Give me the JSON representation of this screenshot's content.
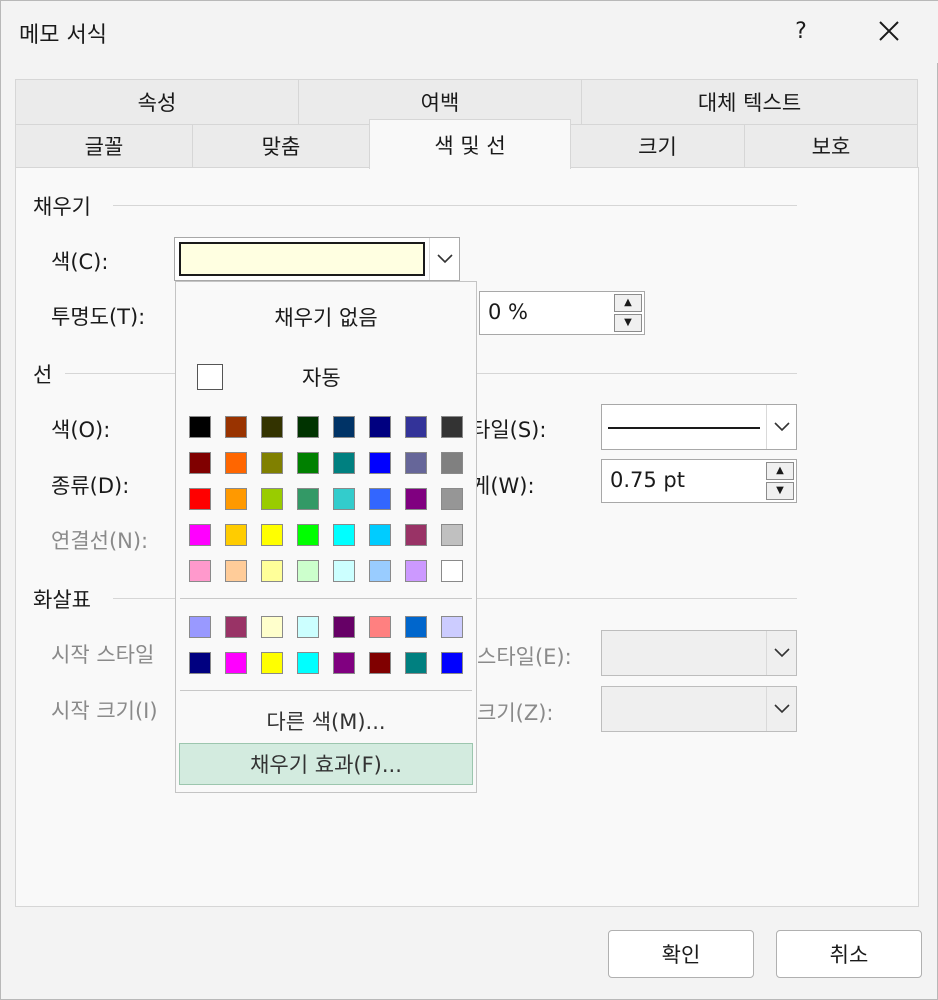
{
  "window": {
    "title": "메모 서식",
    "help": "?",
    "close_icon": "close-icon"
  },
  "tabs_row1": [
    "속성",
    "여백",
    "대체 텍스트"
  ],
  "tabs_row2": [
    "글꼴",
    "맞춤",
    "색 및 선",
    "크기",
    "보호"
  ],
  "active_tab": "색 및 선",
  "fill": {
    "section": "채우기",
    "color_label": "색(C):",
    "color_value": "#ffffe1",
    "transparency_label": "투명도(T):",
    "transparency_value": "0 %"
  },
  "line": {
    "section": "선",
    "color_label": "색(O):",
    "type_label": "종류(D):",
    "connector_label": "연결선(N):",
    "style_label": "타일(S):",
    "weight_label": "게(W):",
    "weight_value": "0.75 pt"
  },
  "arrows": {
    "section": "화살표",
    "begin_style_label": "시작 스타일",
    "begin_size_label": "시작 크기(I)",
    "end_style_label": "스타일(E):",
    "end_size_label": "크기(Z):"
  },
  "color_popup": {
    "no_fill": "채우기 없음",
    "automatic": "자동",
    "more_colors": "다른 색(M)...",
    "fill_effects": "채우기 효과(F)...",
    "standard_colors": [
      [
        "#000000",
        "#993300",
        "#333300",
        "#003300",
        "#003366",
        "#000080",
        "#333399",
        "#333333"
      ],
      [
        "#800000",
        "#ff6600",
        "#808000",
        "#008000",
        "#008080",
        "#0000ff",
        "#666699",
        "#808080"
      ],
      [
        "#ff0000",
        "#ff9900",
        "#99cc00",
        "#339966",
        "#33cccc",
        "#3366ff",
        "#800080",
        "#969696"
      ],
      [
        "#ff00ff",
        "#ffcc00",
        "#ffff00",
        "#00ff00",
        "#00ffff",
        "#00ccff",
        "#993366",
        "#c0c0c0"
      ],
      [
        "#ff99cc",
        "#ffcc99",
        "#ffff99",
        "#ccffcc",
        "#ccffff",
        "#99ccff",
        "#cc99ff",
        "#ffffff"
      ]
    ],
    "extra_colors": [
      [
        "#9999ff",
        "#993366",
        "#ffffcc",
        "#ccffff",
        "#660066",
        "#ff8080",
        "#0066cc",
        "#ccccff"
      ],
      [
        "#000080",
        "#ff00ff",
        "#ffff00",
        "#00ffff",
        "#800080",
        "#800000",
        "#008080",
        "#0000ff"
      ]
    ]
  },
  "buttons": {
    "ok": "확인",
    "cancel": "취소"
  }
}
